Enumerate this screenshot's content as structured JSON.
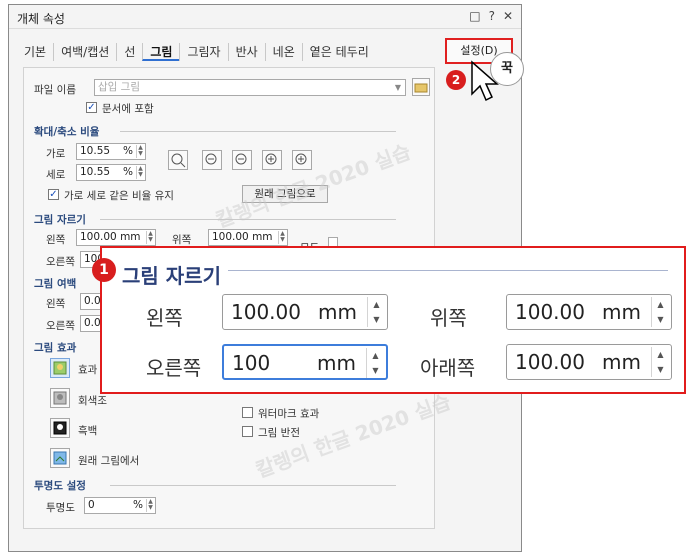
{
  "window": {
    "title": "개체 속성",
    "icons": [
      "comment-icon",
      "help-icon",
      "close-icon"
    ]
  },
  "tabs": [
    "기본",
    "여백/캡션",
    "선",
    "그림",
    "그림자",
    "반사",
    "네온",
    "옅은 테두리"
  ],
  "settings_button": "설정(D)",
  "callout_text": "꾹",
  "picture": {
    "filename_label": "파일 이름",
    "filename_value": "삽입 그림",
    "embed_label": "문서에 포함"
  },
  "scale": {
    "section": "확대/축소 비율",
    "width_label": "가로",
    "width_value": "10.55",
    "width_unit": "%",
    "height_label": "세로",
    "height_value": "10.55",
    "height_unit": "%",
    "zoom_icons": [
      "100%",
      "1/2",
      "1/3",
      "3/2",
      "×2"
    ],
    "keep_ratio_label": "가로 세로 같은 비율 유지",
    "original_button": "원래 그림으로"
  },
  "crop": {
    "section": "그림 자르기",
    "left_label": "왼쪽",
    "left_value": "100.00 mm",
    "top_label": "위쪽",
    "top_value": "100.00 mm",
    "right_label": "오른쪽",
    "right_value": "100",
    "all_label": "모두"
  },
  "margin": {
    "section": "그림 여백",
    "left_label": "왼쪽",
    "left_value": "0.00",
    "right_label": "오른쪽",
    "right_value": "0.00"
  },
  "effects": {
    "section": "그림 효과",
    "items": [
      "효과 없음",
      "회색조",
      "흑백",
      "원래 그림에서"
    ],
    "watermark_label": "워터마크 효과",
    "invert_label": "그림 반전"
  },
  "transparency": {
    "section": "투명도 설정",
    "label": "투명도",
    "value": "0",
    "unit": "%"
  },
  "zoom_panel": {
    "badge": "1",
    "title": "그림 자르기",
    "left_label": "왼쪽",
    "left_value": "100.00",
    "left_unit": "mm",
    "top_label": "위쪽",
    "top_value": "100.00",
    "top_unit": "mm",
    "right_label": "오른쪽",
    "right_value": "100",
    "right_unit": "mm",
    "bottom_label": "아래쪽",
    "bottom_value": "100.00",
    "bottom_unit": "mm"
  },
  "badge2": "2",
  "watermark_text": "칼렝의 한글 2020 실습",
  "colors": {
    "accent": "#2f6fd1",
    "highlight": "#e11c1c",
    "section": "#2b4a7e"
  }
}
